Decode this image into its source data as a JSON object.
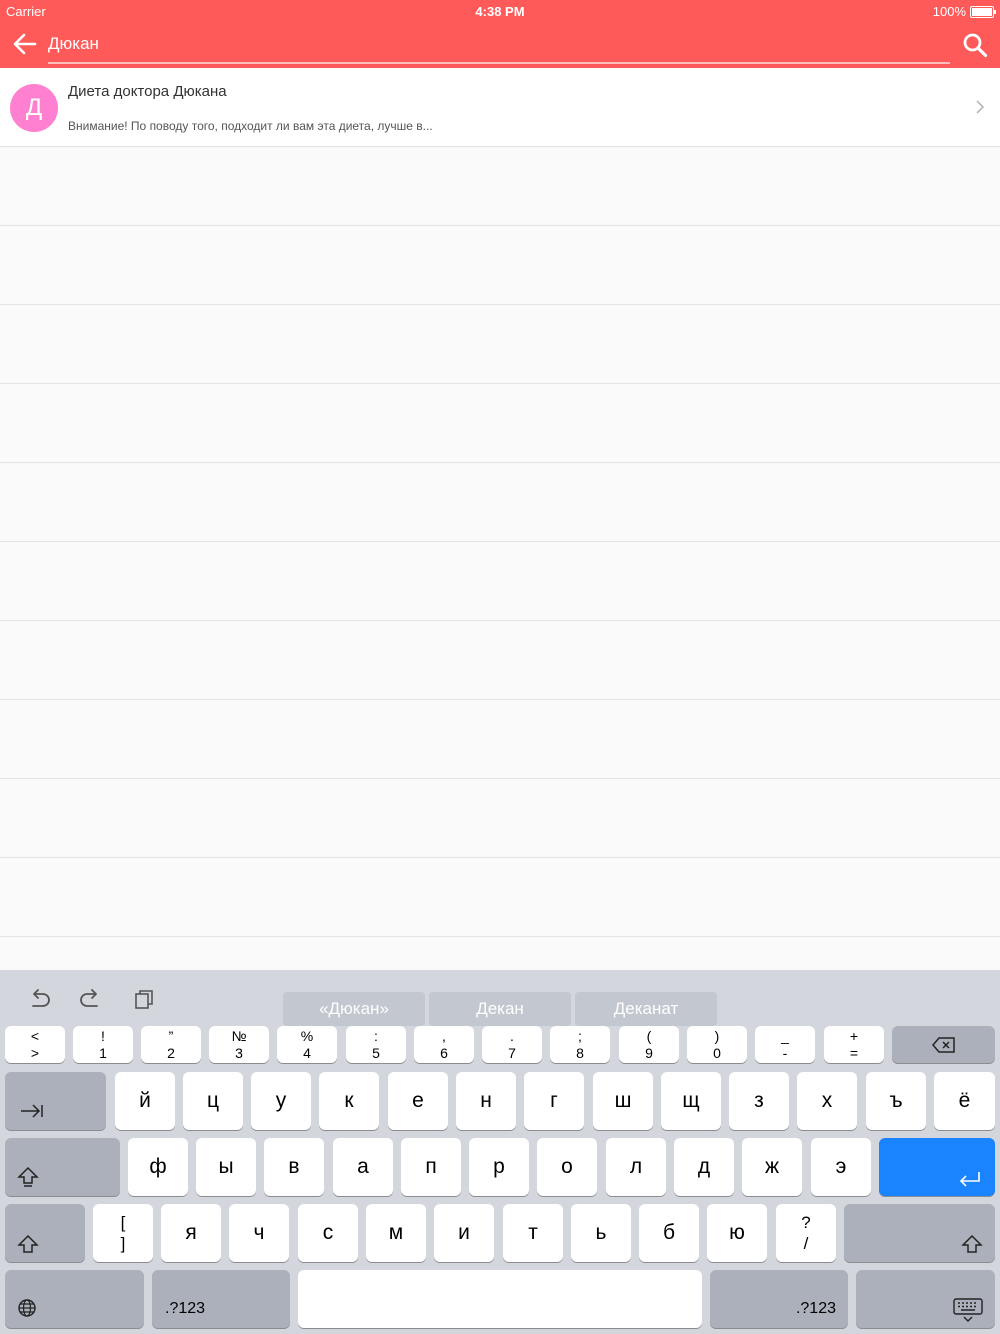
{
  "status_bar": {
    "carrier": "Carrier",
    "time": "4:38 PM",
    "battery": "100%"
  },
  "search": {
    "value": "Дюкан"
  },
  "results": [
    {
      "avatar_letter": "Д",
      "title": "Диета доктора Дюкана",
      "subtitle": "Внимание! По поводу того, подходит ли вам эта диета, лучше в..."
    }
  ],
  "colors": {
    "header": "#ff5a5a",
    "avatar": "#ff80d0",
    "return_key": "#1a84ff"
  },
  "keyboard": {
    "suggestions": [
      "«Дюкан»",
      "Декан",
      "Деканат"
    ],
    "number_row": [
      {
        "top": "<",
        "bottom": ">"
      },
      {
        "top": "!",
        "bottom": "1"
      },
      {
        "top": "”",
        "bottom": "2"
      },
      {
        "top": "№",
        "bottom": "3"
      },
      {
        "top": "%",
        "bottom": "4"
      },
      {
        "top": ":",
        "bottom": "5"
      },
      {
        "top": ",",
        "bottom": "6"
      },
      {
        "top": ".",
        "bottom": "7"
      },
      {
        "top": ";",
        "bottom": "8"
      },
      {
        "top": "(",
        "bottom": "9"
      },
      {
        "top": ")",
        "bottom": "0"
      },
      {
        "top": "_",
        "bottom": "-"
      },
      {
        "top": "+",
        "bottom": "="
      }
    ],
    "row1": [
      "й",
      "ц",
      "у",
      "к",
      "е",
      "н",
      "г",
      "ш",
      "щ",
      "з",
      "х",
      "ъ",
      "ё"
    ],
    "row2": [
      "ф",
      "ы",
      "в",
      "а",
      "п",
      "р",
      "о",
      "л",
      "д",
      "ж",
      "э"
    ],
    "row3_bracket": {
      "top": "[",
      "bottom": "]"
    },
    "row3": [
      "я",
      "ч",
      "с",
      "м",
      "и",
      "т",
      "ь",
      "б",
      "ю"
    ],
    "row3_slash": {
      "top": "?",
      "bottom": "/"
    },
    "numbers_label": ".?123"
  }
}
